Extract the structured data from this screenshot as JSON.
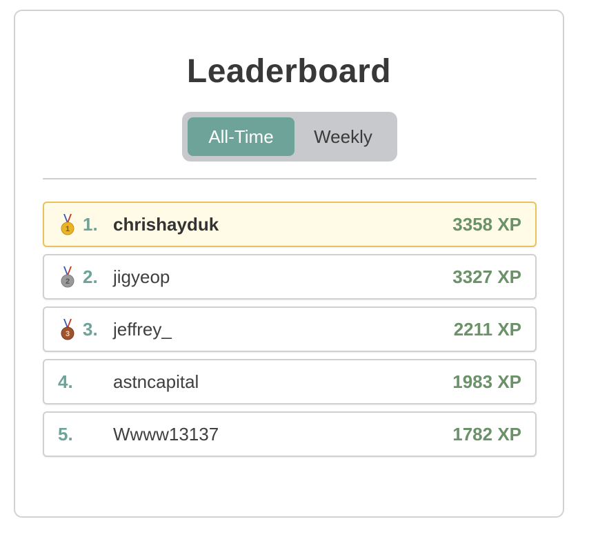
{
  "title": "Leaderboard",
  "tabs": [
    {
      "label": "All-Time",
      "active": true
    },
    {
      "label": "Weekly",
      "active": false
    }
  ],
  "colors": {
    "accent": "#6ea39a",
    "xp": "#6b9168",
    "highlight_bg": "#fffbe6",
    "highlight_border": "#e7c35a",
    "gold": "#e8b528",
    "silver": "#9a9a9a",
    "bronze": "#a0522d"
  },
  "entries": [
    {
      "rank": "1.",
      "name": "chrishayduk",
      "xp": "3358 XP",
      "medal": "gold-medal-icon"
    },
    {
      "rank": "2.",
      "name": "jigyeop",
      "xp": "3327 XP",
      "medal": "silver-medal-icon"
    },
    {
      "rank": "3.",
      "name": "jeffrey_",
      "xp": "2211 XP",
      "medal": "bronze-medal-icon"
    },
    {
      "rank": "4.",
      "name": "astncapital",
      "xp": "1983 XP",
      "medal": ""
    },
    {
      "rank": "5.",
      "name": "Wwww13137",
      "xp": "1782 XP",
      "medal": ""
    }
  ]
}
